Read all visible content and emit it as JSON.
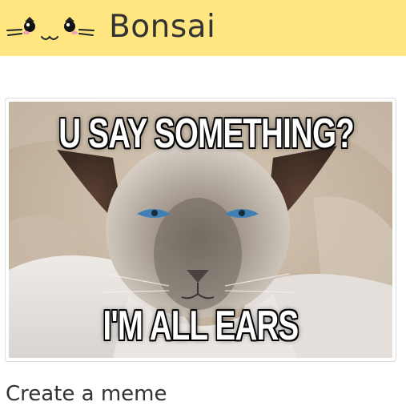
{
  "header": {
    "logo_icon": "kawaii-cat-face-icon",
    "brand": "Bonsai",
    "background_color": "#ffe680"
  },
  "meme": {
    "top_text": "U SAY SOMETHING?",
    "bottom_text": "I'M ALL EARS",
    "image_subject": "siamese-cat-photo"
  },
  "footer": {
    "create_link_label": "Create a meme"
  }
}
